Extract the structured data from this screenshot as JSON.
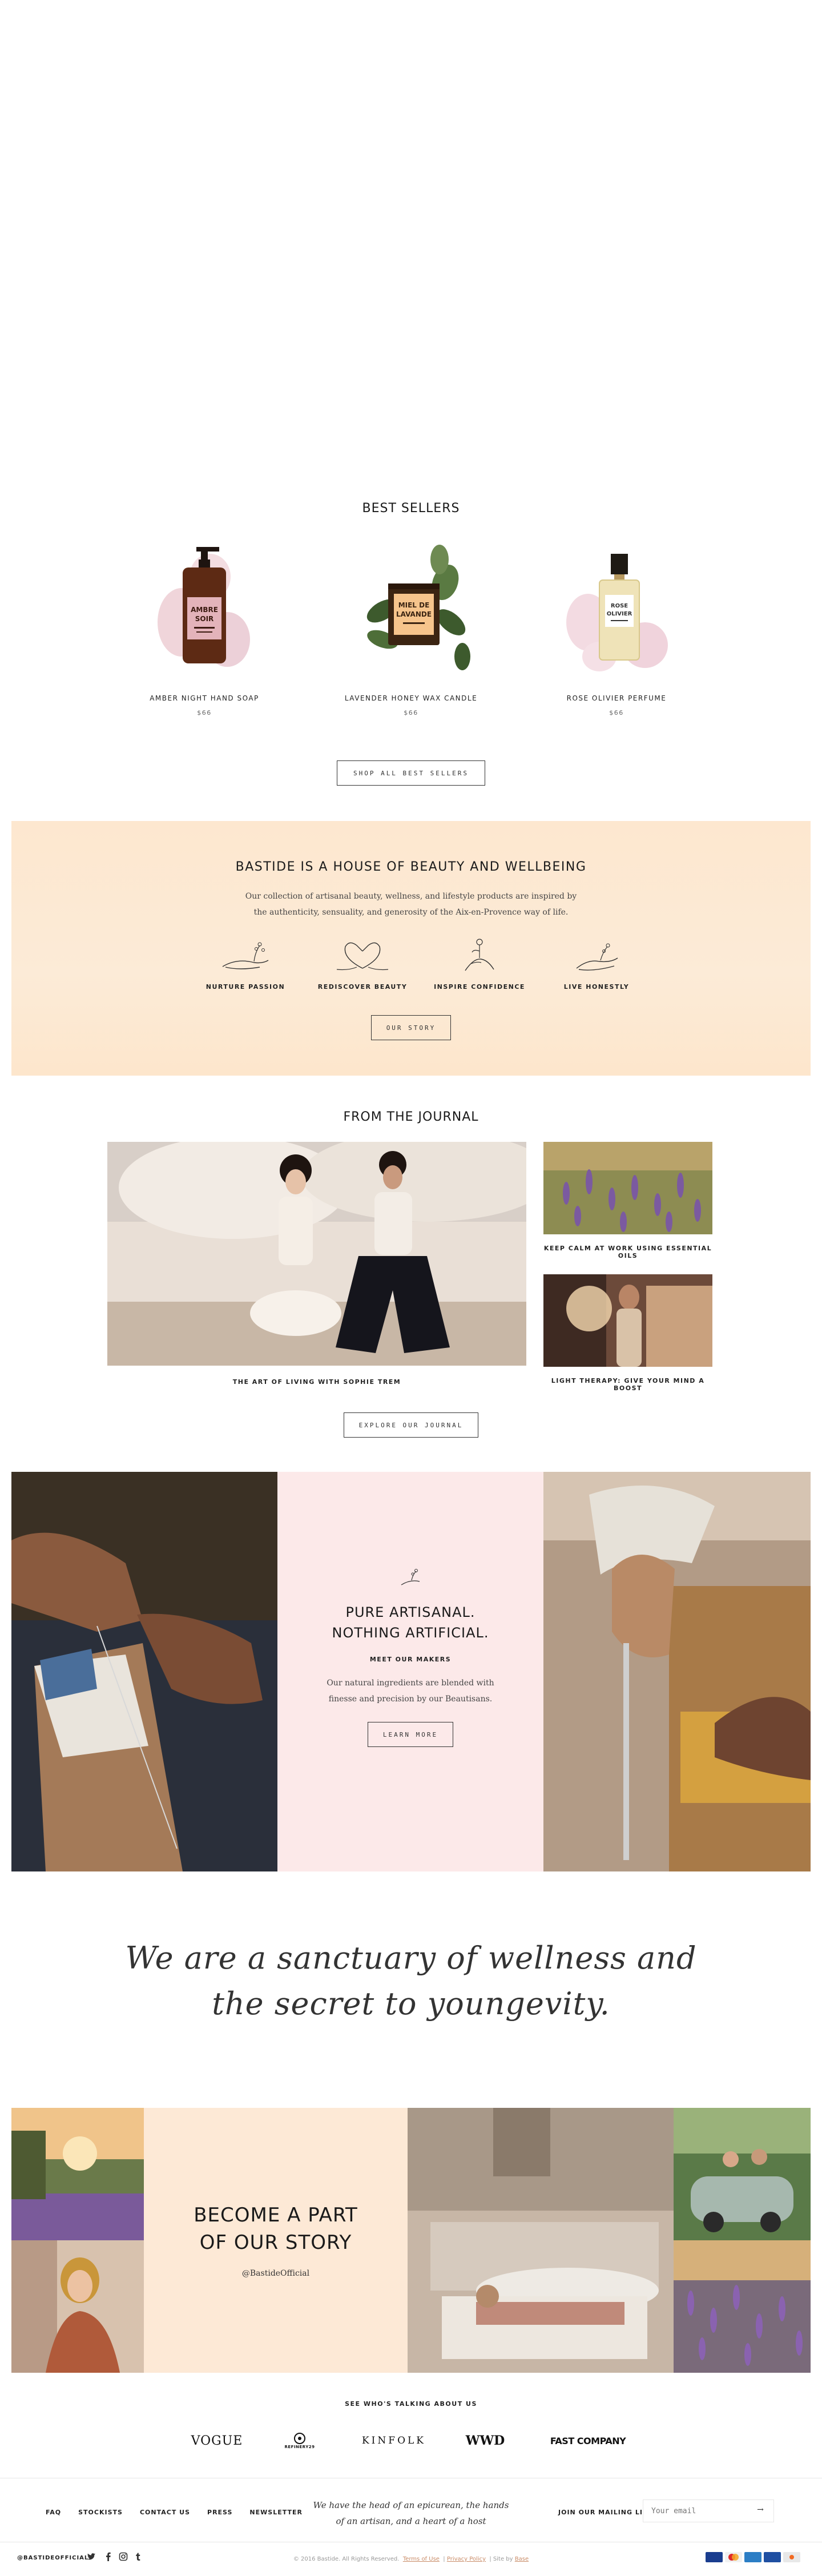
{
  "colors": {
    "accent_peach": "#fde7cf",
    "accent_pink": "#fce9e9",
    "link": "#c98c68"
  },
  "best_sellers": {
    "title": "BEST SELLERS",
    "products": [
      {
        "name": "AMBER NIGHT HAND SOAP",
        "price": "$66",
        "label_top": "AMBRE",
        "label_bottom": "SOIR",
        "icon": "soap-bottle-icon"
      },
      {
        "name": "LAVENDER HONEY WAX CANDLE",
        "price": "$66",
        "label_top": "MIEL DE",
        "label_bottom": "LAVANDE",
        "icon": "candle-icon"
      },
      {
        "name": "ROSE OLIVIER PERFUME",
        "price": "$66",
        "label_top": "ROSE",
        "label_bottom": "OLIVIER",
        "icon": "perfume-icon"
      }
    ],
    "button": "SHOP ALL BEST SELLERS"
  },
  "house": {
    "title": "BASTIDE IS A HOUSE OF BEAUTY AND WELLBEING",
    "text": "Our collection of artisanal beauty, wellness, and lifestyle products are inspired by the authenticity, sensuality, and generosity of the Aix-en-Provence way of life.",
    "values": [
      {
        "label": "NURTURE PASSION",
        "icon": "hand-sprig-icon"
      },
      {
        "label": "REDISCOVER BEAUTY",
        "icon": "heart-hands-icon"
      },
      {
        "label": "INSPIRE CONFIDENCE",
        "icon": "flower-hand-icon"
      },
      {
        "label": "LIVE HONESTLY",
        "icon": "open-hand-icon"
      }
    ],
    "button": "OUR STORY"
  },
  "journal": {
    "title": "FROM THE JOURNAL",
    "articles": [
      {
        "caption": "THE ART OF LIVING WITH SOPHIE TREM"
      },
      {
        "caption": "KEEP CALM AT WORK USING ESSENTIAL OILS"
      },
      {
        "caption": "LIGHT THERAPY: GIVE YOUR MIND A BOOST"
      }
    ],
    "button": "EXPLORE OUR JOURNAL"
  },
  "artisanal": {
    "title_line1": "PURE ARTISANAL.",
    "title_line2": "NOTHING ARTIFICIAL.",
    "subtitle": "MEET OUR MAKERS",
    "text": "Our natural ingredients are blended with finesse and precision by our Beautisans.",
    "button": "LEARN MORE"
  },
  "quote": {
    "line1": "We are a sanctuary of wellness and",
    "line2": "the secret to youngevity."
  },
  "story": {
    "title_line1": "BECOME A PART",
    "title_line2": "OF OUR STORY",
    "handle": "@BastideOfficial"
  },
  "press": {
    "title": "SEE WHO'S TALKING ABOUT US",
    "logos": [
      "VOGUE",
      "REFINERY29",
      "KINFOLK",
      "WWD",
      "FAST COMPANY"
    ]
  },
  "footer": {
    "nav": [
      "FAQ",
      "STOCKISTS",
      "CONTACT US",
      "PRESS",
      "NEWSLETTER"
    ],
    "tagline": "We have the head of an epicurean, the hands of an artisan, and a heart of a host",
    "mailing_label": "JOIN OUR MAILING LIST",
    "email_placeholder": "Your email",
    "handle": "@BASTIDEOFFICIAL",
    "social": [
      "twitter-icon",
      "facebook-icon",
      "instagram-icon",
      "tumblr-icon"
    ],
    "copyright_prefix": "© 2016 Bastide. All Rights Reserved.",
    "terms": "Terms of Use",
    "privacy": "Privacy Policy",
    "site_by_prefix": "Site by",
    "site_by": "Base"
  }
}
